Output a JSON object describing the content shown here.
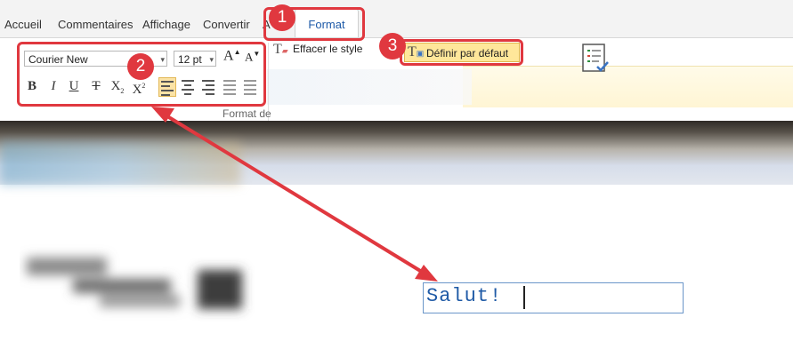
{
  "tabs": {
    "accueil": "Accueil",
    "commentaires": "Commentaires",
    "affichage": "Affichage",
    "convertir": "Convertir",
    "partial": "A",
    "format": "Format"
  },
  "ribbon": {
    "font_name": "Courier New",
    "font_size": "12 pt",
    "grow_font": "A",
    "shrink_font": "A",
    "bold": "B",
    "italic": "I",
    "underline": "U",
    "strikethrough": "T",
    "subscript": "X",
    "superscript": "X",
    "effacer_style": "Effacer le style",
    "definir_defaut": "Définir par défaut",
    "group_label": "Format de"
  },
  "document": {
    "textbox_text": "Salut!"
  },
  "annotations": {
    "step1": "1",
    "step2": "2",
    "step3": "3",
    "accent_color": "#e0383f"
  },
  "colors": {
    "active_tab_text": "#1e5aa8",
    "highlight_button": "#ffe79a",
    "text_blue": "#1f5aa6"
  }
}
